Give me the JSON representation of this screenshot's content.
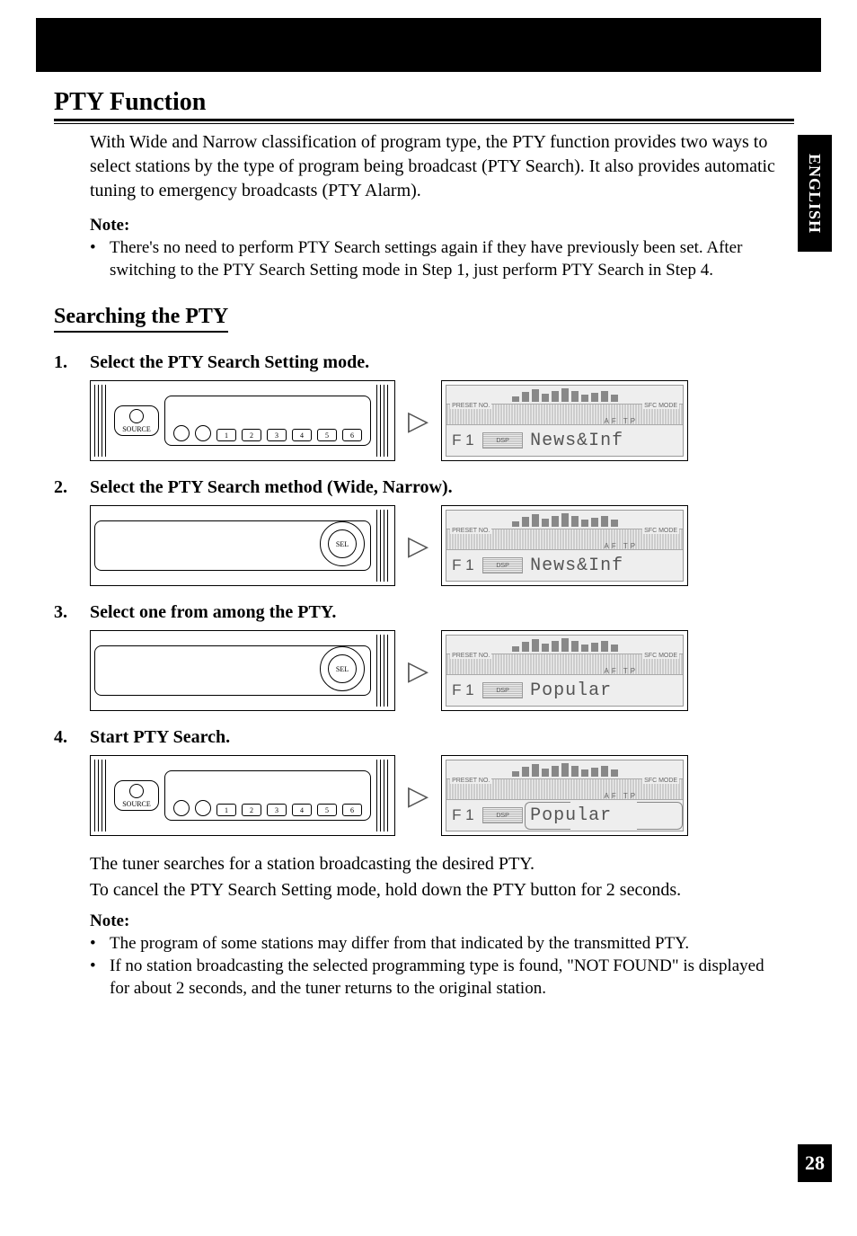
{
  "language_tab": "ENGLISH",
  "page_number": "28",
  "title": "PTY Function",
  "intro": "With Wide and Narrow classification of program type, the PTY function provides two ways to select stations by the type of program being broadcast (PTY Search). It also provides automatic tuning to emergency broadcasts (PTY Alarm).",
  "note1_label": "Note:",
  "note1_items": [
    "There's no need to perform PTY Search settings again if they have previously been set. After switching to the PTY Search Setting mode in Step 1, just perform PTY Search in Step 4."
  ],
  "subheading": "Searching the PTY",
  "steps": [
    {
      "num": "1.",
      "title": "Select the PTY Search Setting mode.",
      "display": "News&Inf",
      "panel_style": "buttons"
    },
    {
      "num": "2.",
      "title": "Select the PTY Search method (Wide, Narrow).",
      "display": "News&Inf",
      "panel_style": "dial"
    },
    {
      "num": "3.",
      "title": "Select one from among the PTY.",
      "display": "Popular",
      "panel_style": "dial"
    },
    {
      "num": "4.",
      "title": "Start PTY Search.",
      "display": "Popular",
      "panel_style": "buttons",
      "boxed": true
    }
  ],
  "result_text1": "The tuner searches for a station broadcasting the desired PTY.",
  "result_text2": "To cancel the PTY Search Setting mode, hold down the PTY button for 2 seconds.",
  "note2_label": "Note:",
  "note2_items": [
    "The program of some stations may differ from that indicated by the transmitted PTY.",
    "If no station broadcasting the selected programming type is found, \"NOT FOUND\" is displayed for about 2 seconds, and the tuner returns to the original station."
  ],
  "labels": {
    "source": "SOURCE",
    "sel": "SEL",
    "dsp": "DSP",
    "preset": "PRESET NO.",
    "sfc": "SFC MODE",
    "aftp": "AF TP",
    "f1": "F 1",
    "btns": [
      "1",
      "2",
      "3",
      "4",
      "5",
      "6"
    ]
  }
}
